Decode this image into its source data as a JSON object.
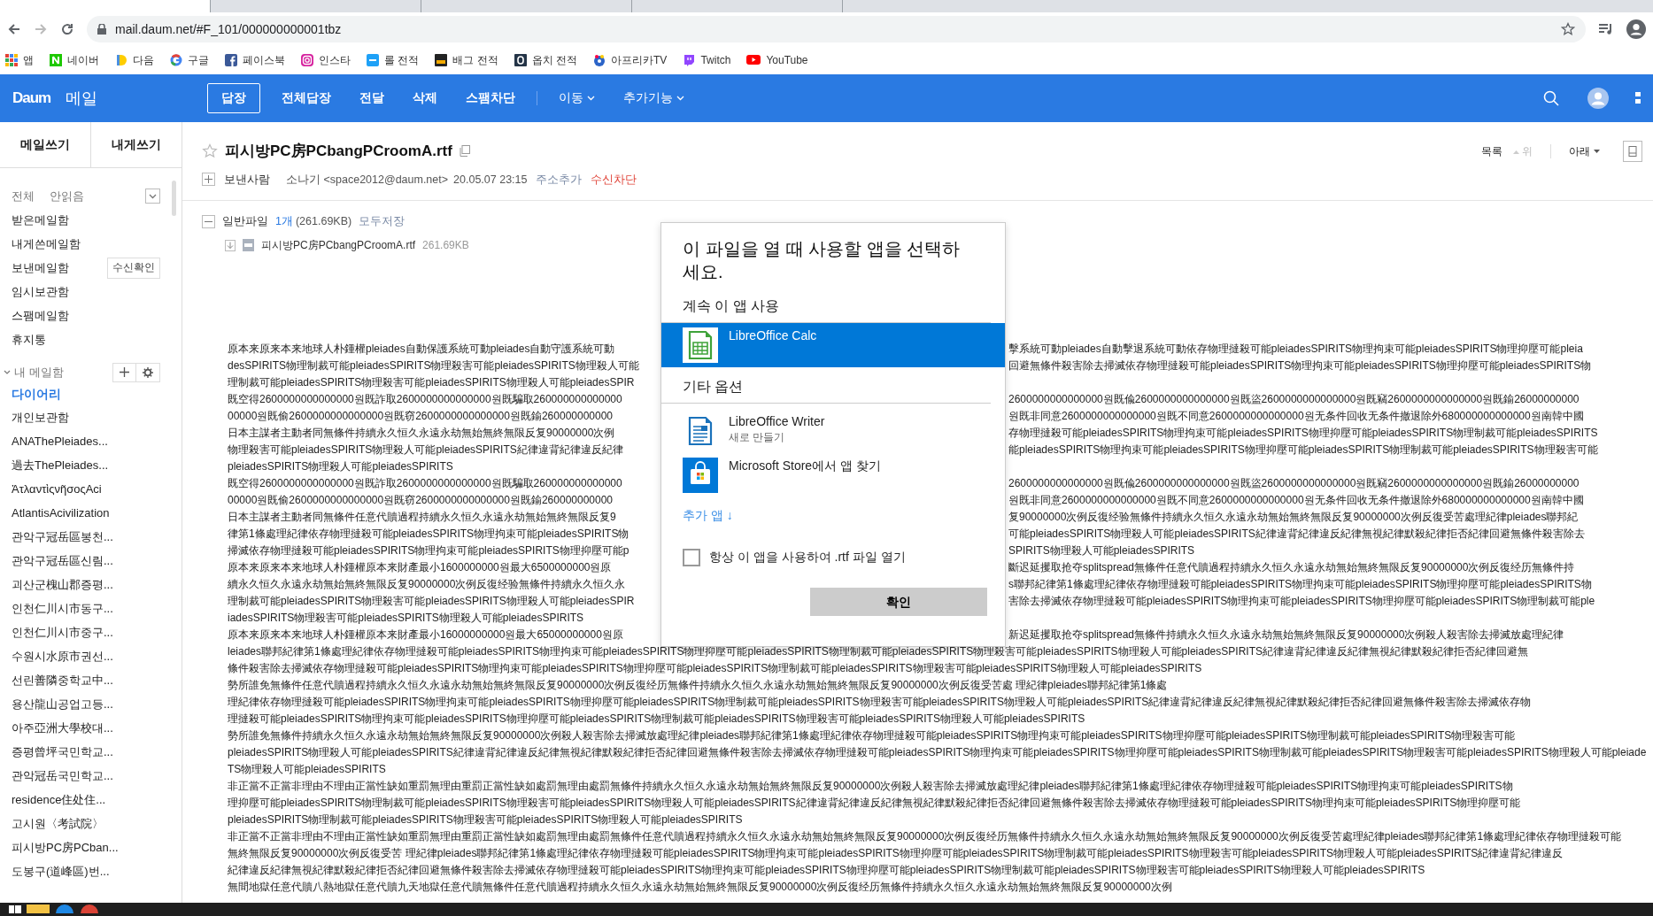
{
  "browser": {
    "tabs": [
      {
        "selected": true
      },
      {
        "selected": false
      },
      {
        "selected": false
      },
      {
        "selected": false
      }
    ],
    "url": "mail.daum.net/#F_101/000000000001tbz",
    "bookmarks": [
      {
        "label": "앱"
      },
      {
        "label": "네이버"
      },
      {
        "label": "다음"
      },
      {
        "label": "구글"
      },
      {
        "label": "페이스북"
      },
      {
        "label": "인스타"
      },
      {
        "label": "롤 전적"
      },
      {
        "label": "배그 전적"
      },
      {
        "label": "옵치 전적"
      },
      {
        "label": "아프리카TV"
      },
      {
        "label": "Twitch"
      },
      {
        "label": "YouTube"
      }
    ]
  },
  "app": {
    "logo": "Daum",
    "service": "메일",
    "toolbar": [
      {
        "label": "답장",
        "kind": "outlined"
      },
      {
        "label": "전체답장",
        "kind": "plain"
      },
      {
        "label": "전달",
        "kind": "plain"
      },
      {
        "label": "삭제",
        "kind": "plain"
      },
      {
        "label": "스팸차단",
        "kind": "plain"
      },
      {
        "label": "이동",
        "kind": "menu"
      },
      {
        "label": "추가기능",
        "kind": "menu"
      }
    ]
  },
  "sidebar": {
    "compose_tabs": [
      "메일쓰기",
      "내게쓰기"
    ],
    "filters": [
      "전체",
      "안읽음"
    ],
    "folders": [
      {
        "label": "받은메일함"
      },
      {
        "label": "내게쓴메일함"
      },
      {
        "label": "보낸메일함",
        "action": "수신확인"
      },
      {
        "label": "임시보관함"
      },
      {
        "label": "스팸메일함"
      },
      {
        "label": "휴지통"
      }
    ],
    "my_mailbox": {
      "label": "내 메일함",
      "expanded": true,
      "items": [
        {
          "label": "다이어리",
          "selected": true
        },
        {
          "label": "개인보관함",
          "selected": false
        },
        {
          "label": "ANAThePleiades...",
          "selected": false
        },
        {
          "label": "過去ThePleiades...",
          "selected": false
        },
        {
          "label": "ἈτλαντὶςνῆσοςAci",
          "selected": false
        },
        {
          "label": "AtlantisAcivilization",
          "selected": false
        },
        {
          "label": "관악구冠岳區봉천...",
          "selected": false
        },
        {
          "label": "관악구冠岳區신림...",
          "selected": false
        },
        {
          "label": "괴산군槐山郡증평...",
          "selected": false
        },
        {
          "label": "인천仁川시市동구...",
          "selected": false
        },
        {
          "label": "인천仁川시市중구...",
          "selected": false
        },
        {
          "label": "수원시水原市권선...",
          "selected": false
        },
        {
          "label": "선린善隣중학교中...",
          "selected": false
        },
        {
          "label": "용산龍山공업고등...",
          "selected": false
        },
        {
          "label": "아주亞洲大學校대...",
          "selected": false
        },
        {
          "label": "증평曾坪국민학교...",
          "selected": false
        },
        {
          "label": "관악冠岳국민학교...",
          "selected": false
        },
        {
          "label": "residence住处住...",
          "selected": false
        },
        {
          "label": "고시원〈考試院〉",
          "selected": false
        },
        {
          "label": "피시방PC房PCban...",
          "selected": false
        },
        {
          "label": "도봉구(道峰區)번...",
          "selected": false
        }
      ]
    }
  },
  "message": {
    "subject": "피시방PC房PCbangPCroomA.rtf",
    "starred": false,
    "nav": {
      "list": "목록",
      "up": "위",
      "up_disabled": true,
      "down": "아래"
    },
    "sender_expanded": false,
    "sender_label": "보낸사람",
    "sender": "소나기 <space2012@daum.net>",
    "date": "20.05.07 23:15",
    "add_contact": "주소추가",
    "block": "수신차단",
    "attachments": {
      "expanded": true,
      "label": "일반파일",
      "count": "1개",
      "size": "(261.69KB)",
      "save_all": "모두저장",
      "files": [
        {
          "name": "피시방PC房PCbangPCroomA.rtf",
          "size": "261.69KB"
        }
      ]
    },
    "body_lines": [
      {
        "left": "原本来原来本来地球人朴鍾權pleiades自動保護系統可動pleiades自動守護系統可動",
        "right": "擊系統可動pleiades自動擊退系統可動依存物理撻殺可能pleiadesSPIRITS物理拘束可能pleiadesSPIRITS物理抑壓可能pleia"
      },
      {
        "left": "desSPIRITS物理制裁可能pleiadesSPIRITS物理殺害可能pleiadesSPIRITS物理殺人可能",
        "right": "回避無條件殺害除去掃滅依存物理撻殺可能pleiadesSPIRITS物理拘束可能pleiadesSPIRITS物理抑壓可能pleiadesSPIRITS物"
      },
      {
        "left": "理制裁可能pleiadesSPIRITS物理殺害可能pleiadesSPIRITS物理殺人可能pleiadesSPIR"
      },
      {
        "left": "既空得2600000000000000원既詐取2600000000000000원既騙取260000000000000",
        "right": "2600000000000000원既偸2600000000000000원既盜2600000000000000원既竊2600000000000000원既鍮26000000000"
      },
      {
        "left": "00000원既偷2600000000000000원既窃2600000000000000원既鍮260000000000",
        "right": "원既非同意2600000000000000원既不同意2600000000000000원无条件回收无条件撤退除外680000000000000원南韓中國"
      },
      {
        "left": "日本主謀者主動者同無條件持續永久恒久永遠永劫無始無終無限反复90000000次例",
        "right": "存物理撻殺可能pleiadesSPIRITS物理拘束可能pleiadesSPIRITS物理抑壓可能pleiadesSPIRITS物理制裁可能pleiadesSPIRITS"
      },
      {
        "left": "物理殺害可能pleiadesSPIRITS物理殺人可能pleiadesSPIRITS紀律違背紀律違反紀律",
        "right": "能pleiadesSPIRITS物理拘束可能pleiadesSPIRITS物理抑壓可能pleiadesSPIRITS物理制裁可能pleiadesSPIRITS物理殺害可能"
      },
      {
        "left": "pleiadesSPIRITS物理殺人可能pleiadesSPIRITS"
      },
      {
        "left": "既空得2600000000000000원既詐取2600000000000000원既騙取260000000000000",
        "right": "2600000000000000원既偸2600000000000000원既盜2600000000000000원既竊2600000000000000원既鍮26000000000"
      },
      {
        "left": "00000원既偷2600000000000000원既窃2600000000000000원既鍮260000000000",
        "right": "원既非同意2600000000000000원既不同意2600000000000000원无条件回收无条件撤退除外680000000000000원南韓中國"
      },
      {
        "left": "日本主謀者主動者同無條件任意代贖過程持續永久恒久永遠永劫無始無終無限反复9",
        "right": "复90000000次例反復经验無條件持續永久恒久永遠永劫無始無終無限反复90000000次例反復受苦處理紀律pleiades聯邦紀"
      },
      {
        "left": "律第1條處理紀律依存物理撻殺可能pleiadesSPIRITS物理拘束可能pleiadesSPIRITS物",
        "right": "可能pleiadesSPIRITS物理殺人可能pleiadesSPIRITS紀律違背紀律違反紀律無視紀律默殺紀律拒否紀律回避無條件殺害除去"
      },
      {
        "left": "掃滅依存物理撻殺可能pleiadesSPIRITS物理拘束可能pleiadesSPIRITS物理抑壓可能p",
        "right": "SPIRITS物理殺人可能pleiadesSPIRITS"
      },
      {
        "left": "原本来原来本来地球人朴鍾權原本来財產最小1600000000원最大6500000000원原",
        "right": "斷迟延攫取抢夺splitspread無條件任意代贖過程持續永久恒久永遠永劫無始無終無限反复90000000次例反復经历無條件持"
      },
      {
        "left": "續永久恒久永遠永劫無始無終無限反复90000000次例反復经验無條件持續永久恒久永",
        "right": "s聯邦紀律第1條處理紀律依存物理撻殺可能pleiadesSPIRITS物理拘束可能pleiadesSPIRITS物理抑壓可能pleiadesSPIRITS物"
      },
      {
        "left": "理制裁可能pleiadesSPIRITS物理殺害可能pleiadesSPIRITS物理殺人可能pleiadesSPIR",
        "right": "害除去掃滅依存物理撻殺可能pleiadesSPIRITS物理拘束可能pleiadesSPIRITS物理抑壓可能pleiadesSPIRITS物理制裁可能ple"
      },
      {
        "left": "iadesSPIRITS物理殺害可能pleiadesSPIRITS物理殺人可能pleiadesSPIRITS"
      },
      {
        "left": "原本来原来本来地球人朴鍾權原本来財產最小16000000000원最大65000000000원原",
        "right": "新迟延攫取抢夺splitspread無條件持續永久恒久永遠永劫無始無終無限反复90000000次例殺人殺害除去掃滅放處理紀律"
      },
      {
        "text": "leiades聯邦紀律第1條處理紀律依存物理撻殺可能pleiadesSPIRITS物理拘束可能pleiadesSPIRITS物理抑壓可能pleiadesSPIRITS物理制裁可能pleiadesSPIRITS物理殺害可能pleiadesSPIRITS物理殺人可能pleiadesSPIRITS紀律違背紀律違反紀律無視紀律默殺紀律拒否紀律回避無"
      },
      {
        "text": "條件殺害除去掃滅依存物理撻殺可能pleiadesSPIRITS物理拘束可能pleiadesSPIRITS物理抑壓可能pleiadesSPIRITS物理制裁可能pleiadesSPIRITS物理殺害可能pleiadesSPIRITS物理殺人可能pleiadesSPIRITS"
      },
      {
        "text": "勢所誰免無條件任意代贖過程持續永久恒久永遠永劫無始無終無限反复90000000次例反復经历無條件持續永久恒久永遠永劫無始無終無限反复90000000次例反復受苦處 理紀律pleiades聯邦紀律第1條處"
      },
      {
        "text": "理紀律依存物理撻殺可能pleiadesSPIRITS物理拘束可能pleiadesSPIRITS物理抑壓可能pleiadesSPIRITS物理制裁可能pleiadesSPIRITS物理殺害可能pleiadesSPIRITS物理殺人可能pleiadesSPIRITS紀律違背紀律違反紀律無視紀律默殺紀律拒否紀律回避無條件殺害除去掃滅依存物"
      },
      {
        "text": "理撻殺可能pleiadesSPIRITS物理拘束可能pleiadesSPIRITS物理抑壓可能pleiadesSPIRITS物理制裁可能pleiadesSPIRITS物理殺害可能pleiadesSPIRITS物理殺人可能pleiadesSPIRITS"
      },
      {
        "text": "勢所誰免無條件持續永久恒久永遠永劫無始無終無限反复90000000次例殺人殺害除去掃滅放處理紀律pleiades聯邦紀律第1條處理紀律依存物理撻殺可能pleiadesSPIRITS物理拘束可能pleiadesSPIRITS物理抑壓可能pleiadesSPIRITS物理制裁可能pleiadesSPIRITS物理殺害可能"
      },
      {
        "text": "pleiadesSPIRITS物理殺人可能pleiadesSPIRITS紀律違背紀律違反紀律無視紀律默殺紀律拒否紀律回避無條件殺害除去掃滅依存物理撻殺可能pleiadesSPIRITS物理拘束可能pleiadesSPIRITS物理抑壓可能pleiadesSPIRITS物理制裁可能pleiadesSPIRITS物理殺害可能pleiadesSPIRITS物理殺人可能pleiade"
      },
      {
        "text": "TS物理殺人可能pleiadesSPIRITS"
      },
      {
        "text": "非正當不正當非理由不理由正當性缺如重罰無理由重罰正當性缺如處罰無理由處罰無條件持續永久恒久永遠永劫無始無終無限反复90000000次例殺人殺害除去掃滅放處理紀律pleiades聯邦紀律第1條處理紀律依存物理撻殺可能pleiadesSPIRITS物理拘束可能pleiadesSPIRITS物"
      },
      {
        "text": "理抑壓可能pleiadesSPIRITS物理制裁可能pleiadesSPIRITS物理殺害可能pleiadesSPIRITS物理殺人可能pleiadesSPIRITS紀律違背紀律違反紀律無視紀律默殺紀律拒否紀律回避無條件殺害除去掃滅依存物理撻殺可能pleiadesSPIRITS物理拘束可能pleiadesSPIRITS物理抑壓可能"
      },
      {
        "text": "pleiadesSPIRITS物理制裁可能pleiadesSPIRITS物理殺害可能pleiadesSPIRITS物理殺人可能pleiadesSPIRITS"
      },
      {
        "text": "非正當不正當非理由不理由正當性缺如重罰無理由重罰正當性缺如處罰無理由處罰無條件任意代贖過程持續永久恒久永遠永劫無始無終無限反复90000000次例反復经历無條件持續永久恒久永遠永劫無始無終無限反复90000000次例反復受苦處理紀律pleiades聯邦紀律第1條處理紀律依存物理撻殺可能"
      },
      {
        "text": "無終無限反复90000000次例反復受苦 理紀律pleiades聯邦紀律第1條處理紀律依存物理撻殺可能pleiadesSPIRITS物理拘束可能pleiadesSPIRITS物理抑壓可能pleiadesSPIRITS物理制裁可能pleiadesSPIRITS物理殺害可能pleiadesSPIRITS物理殺人可能pleiadesSPIRITS紀律違背紀律違反"
      },
      {
        "text": "紀律違反紀律無視紀律默殺紀律拒否紀律回避無條件殺害除去掃滅依存物理撻殺可能pleiadesSPIRITS物理拘束可能pleiadesSPIRITS物理抑壓可能pleiadesSPIRITS物理制裁可能pleiadesSPIRITS物理殺害可能pleiadesSPIRITS物理殺人可能pleiadesSPIRITS"
      },
      {
        "text": "無間地獄任意代贖八熱地獄任意代贖九天地獄任意代贖無條件任意代贖過程持續永久恒久永遠永劫無始無終無限反复90000000次例反復经历無條件持續永久恒久永遠永劫無始無終無限反复90000000次例"
      }
    ]
  },
  "dialog": {
    "title": "이 파일을 열 때 사용할 앱을 선택하세요.",
    "recommended_heading": "계속 이 앱 사용",
    "recommended": [
      {
        "name": "LibreOffice Calc",
        "selected": true
      }
    ],
    "other_heading": "기타 옵션",
    "others": [
      {
        "name": "LibreOffice Writer",
        "subtitle": "새로 만들기",
        "selected": false
      },
      {
        "name": "Microsoft Store에서 앱 찾기",
        "selected": false
      }
    ],
    "more_apps": "추가 앱 ↓",
    "always_label": "항상 이 앱을 사용하여 .rtf 파일 열기",
    "always_checked": false,
    "ok": "확인"
  }
}
